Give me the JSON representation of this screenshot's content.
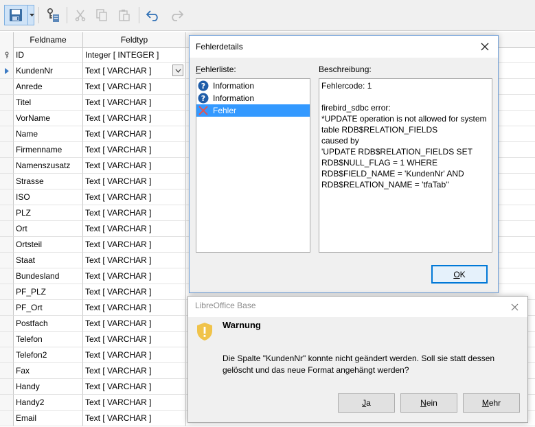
{
  "table": {
    "headers": {
      "fieldname": "Feldname",
      "fieldtype": "Feldtyp"
    },
    "rows": [
      {
        "name": "ID",
        "type": "Integer [ INTEGER ]",
        "marker": "key"
      },
      {
        "name": "KundenNr",
        "type": "Text [ VARCHAR ]",
        "marker": "current"
      },
      {
        "name": "Anrede",
        "type": "Text [ VARCHAR ]"
      },
      {
        "name": "Titel",
        "type": "Text [ VARCHAR ]"
      },
      {
        "name": "VorName",
        "type": "Text [ VARCHAR ]"
      },
      {
        "name": "Name",
        "type": "Text [ VARCHAR ]"
      },
      {
        "name": "Firmenname",
        "type": "Text [ VARCHAR ]"
      },
      {
        "name": "Namenszusatz",
        "type": "Text [ VARCHAR ]"
      },
      {
        "name": "Strasse",
        "type": "Text [ VARCHAR ]"
      },
      {
        "name": "ISO",
        "type": "Text [ VARCHAR ]"
      },
      {
        "name": "PLZ",
        "type": "Text [ VARCHAR ]"
      },
      {
        "name": "Ort",
        "type": "Text [ VARCHAR ]"
      },
      {
        "name": "Ortsteil",
        "type": "Text [ VARCHAR ]"
      },
      {
        "name": "Staat",
        "type": "Text [ VARCHAR ]"
      },
      {
        "name": "Bundesland",
        "type": "Text [ VARCHAR ]"
      },
      {
        "name": "PF_PLZ",
        "type": "Text [ VARCHAR ]"
      },
      {
        "name": "PF_Ort",
        "type": "Text [ VARCHAR ]"
      },
      {
        "name": "Postfach",
        "type": "Text [ VARCHAR ]"
      },
      {
        "name": "Telefon",
        "type": "Text [ VARCHAR ]"
      },
      {
        "name": "Telefon2",
        "type": "Text [ VARCHAR ]"
      },
      {
        "name": "Fax",
        "type": "Text [ VARCHAR ]"
      },
      {
        "name": "Handy",
        "type": "Text [ VARCHAR ]"
      },
      {
        "name": "Handy2",
        "type": "Text [ VARCHAR ]"
      },
      {
        "name": "Email",
        "type": "Text [ VARCHAR ]"
      }
    ]
  },
  "error_dialog": {
    "title": "Fehlerdetails",
    "list_label": "Fehlerliste:",
    "list_label_mnemonic": "F",
    "list_label_rest": "ehlerliste:",
    "desc_label": "Beschreibung:",
    "items": [
      {
        "label": "Information",
        "icon": "question-icon"
      },
      {
        "label": "Information",
        "icon": "question-icon"
      },
      {
        "label": "Fehler",
        "icon": "error-x-icon",
        "selected": true
      }
    ],
    "description_lines": [
      "Fehlercode: 1",
      "",
      "firebird_sdbc error:",
      "*UPDATE operation is not allowed for system",
      "table RDB$RELATION_FIELDS",
      "caused by",
      "'UPDATE RDB$RELATION_FIELDS SET",
      "RDB$NULL_FLAG = 1 WHERE",
      "RDB$FIELD_NAME = 'KundenNr' AND",
      "RDB$RELATION_NAME = 'tfaTab''"
    ],
    "ok_mnemonic": "O",
    "ok_rest": "K"
  },
  "warning_dialog": {
    "title": "LibreOffice Base",
    "heading": "Warnung",
    "message": "Die Spalte \"KundenNr\" konnte nicht geändert werden. Soll sie statt dessen gelöscht und das neue Format angehängt werden?",
    "buttons": [
      {
        "mnemonic": "J",
        "rest": "a"
      },
      {
        "mnemonic": "N",
        "rest": "ein"
      },
      {
        "mnemonic": "M",
        "rest": "ehr"
      }
    ]
  },
  "colors": {
    "accent": "#0078d7",
    "selection": "#3399ff",
    "warning": "#f0c34a",
    "error": "#e05555"
  }
}
